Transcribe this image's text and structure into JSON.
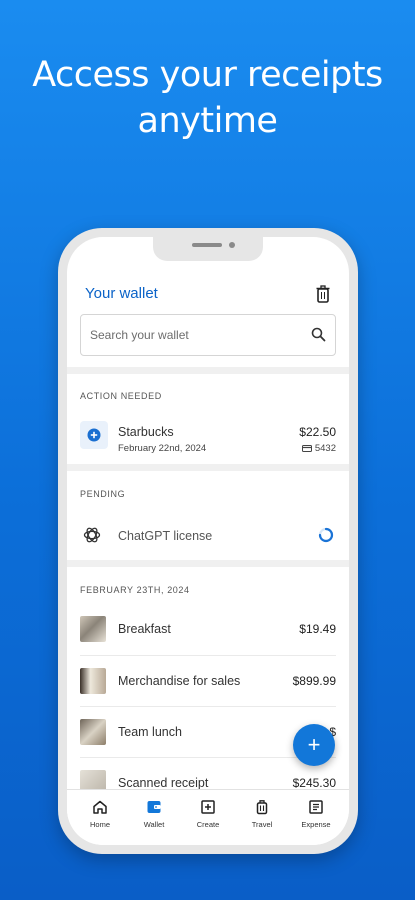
{
  "headline": {
    "line1": "Access your receipts",
    "line2": "anytime"
  },
  "header": {
    "title": "Your wallet",
    "trash_icon": "trash-icon"
  },
  "search": {
    "placeholder": "Search your wallet",
    "icon": "search-icon"
  },
  "action_needed": {
    "label": "ACTION NEEDED",
    "item": {
      "name": "Starbucks",
      "date": "February 22nd, 2024",
      "amount": "$22.50",
      "card": "5432",
      "icon": "plus-circle-icon"
    }
  },
  "pending": {
    "label": "PENDING",
    "item": {
      "name": "ChatGPT license",
      "icon": "openai-logo-icon",
      "status_icon": "loading-spinner-icon"
    }
  },
  "date_group": {
    "label": "FEBRUARY 23TH, 2024",
    "items": [
      {
        "name": "Breakfast",
        "amount": "$19.49"
      },
      {
        "name": "Merchandise for sales",
        "amount": "$899.99"
      },
      {
        "name": "Team lunch",
        "amount": "$"
      },
      {
        "name": "Scanned receipt",
        "amount": "$245.30"
      }
    ]
  },
  "fab": {
    "label": "+"
  },
  "nav": {
    "items": [
      {
        "label": "Home",
        "icon": "home-icon"
      },
      {
        "label": "Wallet",
        "icon": "wallet-icon"
      },
      {
        "label": "Create",
        "icon": "create-icon"
      },
      {
        "label": "Travel",
        "icon": "luggage-icon"
      },
      {
        "label": "Expense",
        "icon": "expense-report-icon"
      }
    ]
  },
  "colors": {
    "accent": "#0b63c8",
    "fab": "#1277d9",
    "background_top": "#1a8cf0",
    "background_bottom": "#0a5ec7"
  }
}
